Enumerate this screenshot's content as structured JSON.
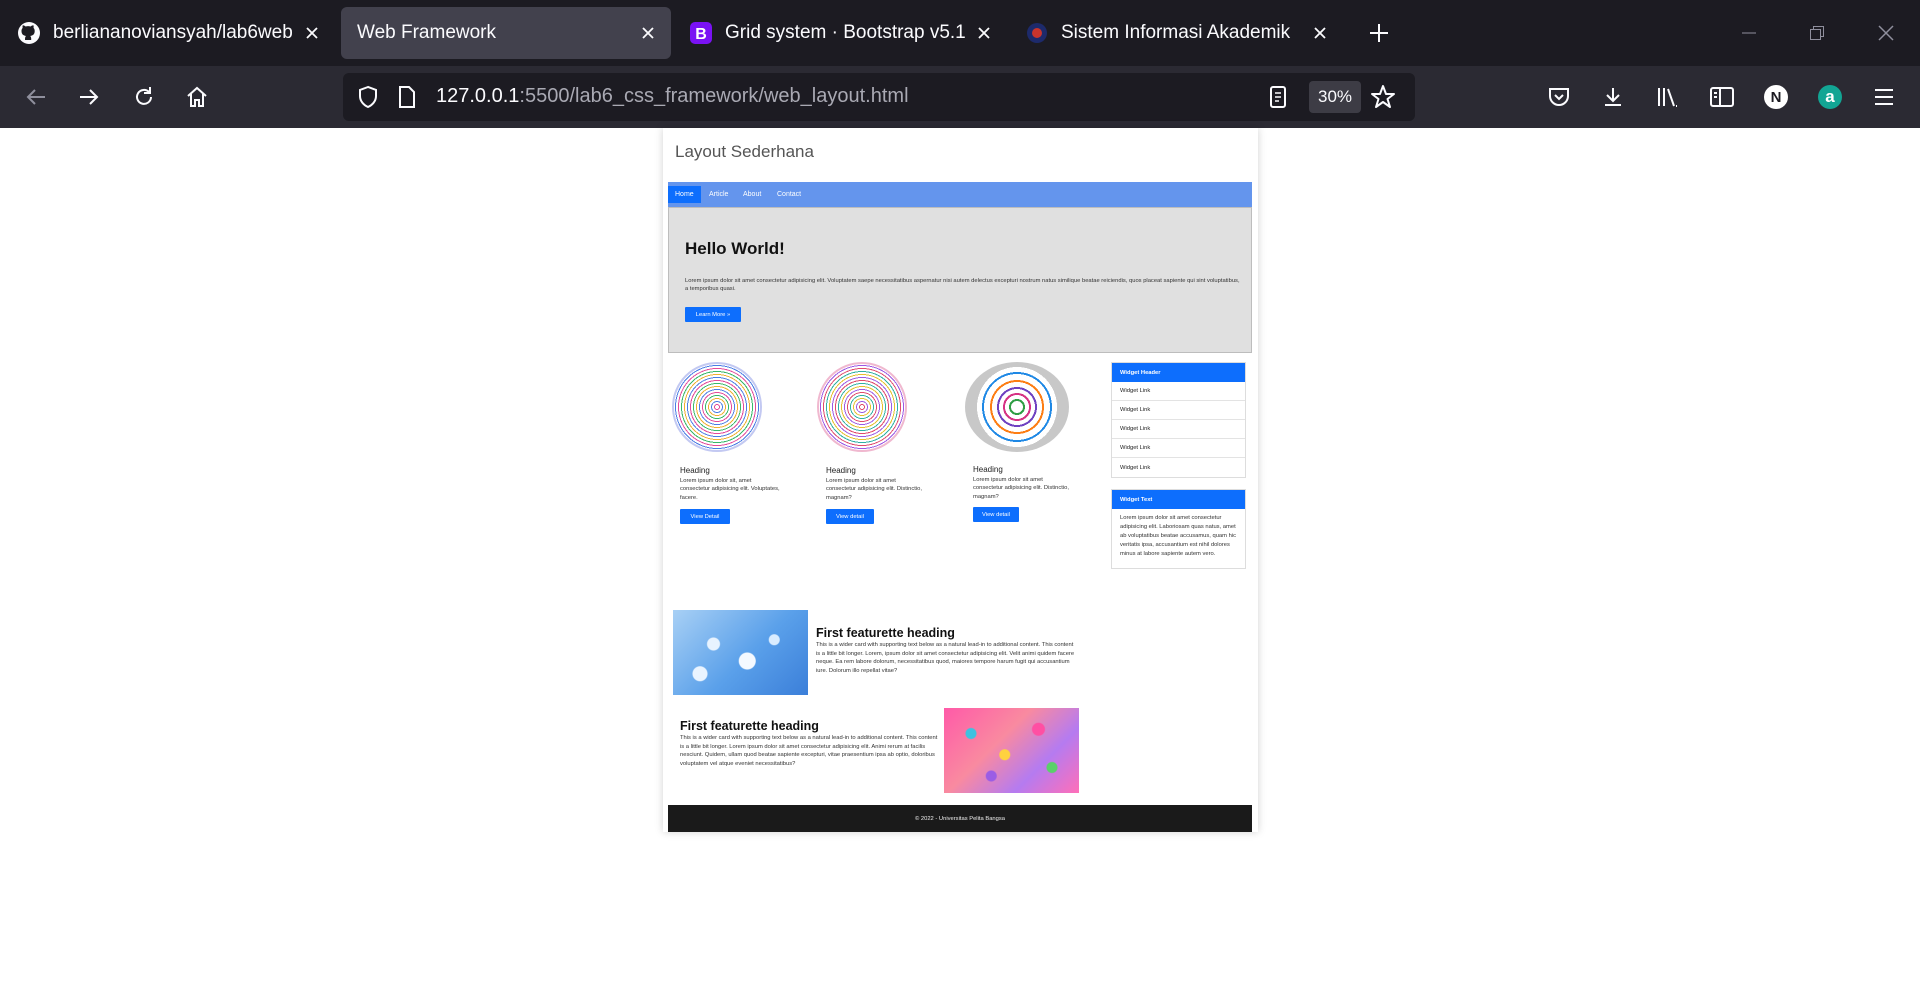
{
  "browser": {
    "tabs": [
      {
        "title": "berliananoviansyah/lab6web",
        "icon": "github-icon",
        "active": false
      },
      {
        "title": "Web Framework",
        "icon": "none",
        "active": true
      },
      {
        "title": "Grid system · Bootstrap v5.1",
        "icon": "bootstrap-icon",
        "active": false
      },
      {
        "title": "Sistem Informasi Akademik",
        "icon": "university-logo-icon",
        "active": false
      }
    ],
    "url_host": "127.0.0.1",
    "url_rest": ":5500/lab6_css_framework/web_layout.html",
    "zoom": "30%",
    "profile_initial": "N",
    "extension_initial": "a"
  },
  "site": {
    "title": "Layout Sederhana",
    "nav": [
      "Home",
      "Article",
      "About",
      "Contact"
    ],
    "hero": {
      "heading": "Hello World!",
      "text": "Lorem ipsum dolor sit amet consectetur adipisicing elit. Voluptatem saepe necessitatibus aspernatur nisi autem delectus excepturi nostrum natus similique beatae reiciendis, quos placeat sapiente qui sint voluptatibus, a temporibus quasi.",
      "button": "Learn More »"
    },
    "columns": [
      {
        "heading": "Heading",
        "text": "Lorem ipsum dolor sit, amet consectetur adipisicing elit. Voluptates, facere.",
        "button": "View Detail"
      },
      {
        "heading": "Heading",
        "text": "Lorem ipsum dolor sit amet consectetur adipisicing elit. Distinctio, magnam?",
        "button": "View detail"
      },
      {
        "heading": "Heading",
        "text": "Lorem ipsum dolor sit amet consectetur adipisicing elit. Distinctio, magnam?",
        "button": "View detail"
      }
    ],
    "widget_links": {
      "header": "Widget Header",
      "links": [
        "Widget Link",
        "Widget Link",
        "Widget Link",
        "Widget Link",
        "Widget Link"
      ]
    },
    "widget_text": {
      "header": "Widget Text",
      "text": "Lorem ipsum dolor sit amet consectetur adipisicing elit. Laboriosam quas natus, amet ab voluptatibus beatae accusamus, quam hic veritatis ipsa, accusantium est nihil dolores minus at labore sapiente autem vero."
    },
    "featurettes": [
      {
        "heading": "First featurette heading",
        "text": "This is a wider card with supporting text below as a natural lead-in to additional content. This content is a little bit longer. Lorem, ipsum dolor sit amet consectetur adipisicing elit. Velit animi quidem facere neque. Ea rem labore dolorum, necessitatibus quod, maiores tempore harum fugit qui accusantium iure. Dolorum illo repellat vitae?"
      },
      {
        "heading": "First featurette heading",
        "text": "This is a wider card with supporting text below as a natural lead-in to additional content. This content is a little bit longer. Lorem ipsum dolor sit amet consectetur adipisicing elit. Animi rerum at facilis nesciunt. Quidem, ullam quod beatae sapiente excepturi, vitae praesentium ipsa ab optio, doloribus voluptatem vel atque eveniet necessitatibus?"
      }
    ],
    "footer": "© 2022 - Universitas Pelita Bangsa"
  }
}
